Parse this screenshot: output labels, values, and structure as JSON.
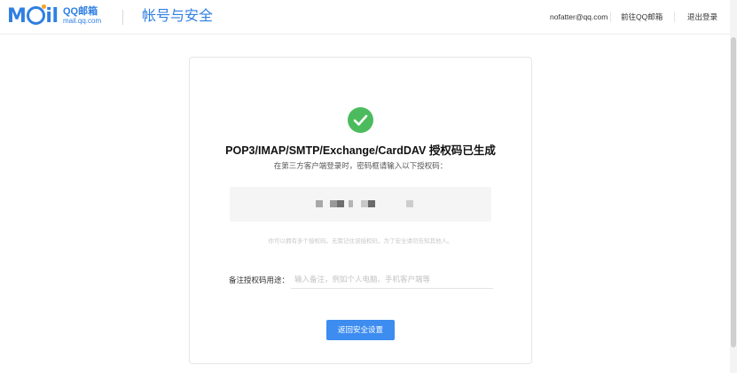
{
  "header": {
    "logo_text": "Mail",
    "logo_brand": "QQ邮箱",
    "logo_domain": "mail.qq.com",
    "page_title": "帐号与安全",
    "user_email": "nofatter@qq.com",
    "goto_mail_label": "前往QQ邮箱",
    "logout_label": "退出登录"
  },
  "card": {
    "success_icon": "check-circle-icon",
    "title": "POP3/IMAP/SMTP/Exchange/CardDAV 授权码已生成",
    "subtitle": "在第三方客户端登录时，密码框请输入以下授权码：",
    "code_masked": "(授权码已打码)",
    "hint": "你可以拥有多个授权码。无需记住该授权码，为了安全请勿告知其他人。",
    "note_label": "备注授权码用途：",
    "note_value": "",
    "note_placeholder": "输入备注，例如个人电脑、手机客户端等",
    "back_button_label": "返回安全设置"
  },
  "colors": {
    "brand_blue": "#2f7fe3",
    "button_blue": "#3d8cf0",
    "success_green": "#4cbb5d"
  }
}
